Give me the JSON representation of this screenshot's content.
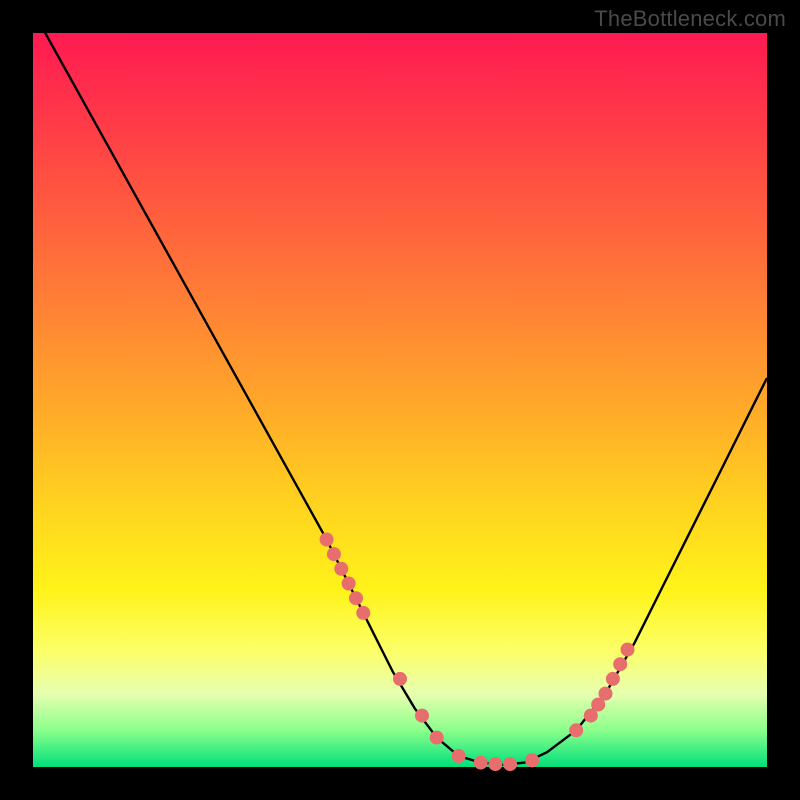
{
  "watermark": "TheBottleneck.com",
  "colors": {
    "page_bg": "#000000",
    "gradient_top": "#ff1a52",
    "gradient_bottom": "#00e07a",
    "curve_stroke": "#000000",
    "marker_fill": "#e86d6d",
    "marker_stroke": "#c94f4f"
  },
  "chart_data": {
    "type": "line",
    "title": "",
    "xlabel": "",
    "ylabel": "",
    "xlim": [
      0,
      100
    ],
    "ylim": [
      0,
      100
    ],
    "grid": false,
    "legend": false,
    "note": "Axes are unlabeled. y interpreted as 0=bottom (green, optimal) to 100=top (red, bottleneck). Values estimated from pixel positions.",
    "series": [
      {
        "name": "bottleneck-curve",
        "x": [
          0,
          5,
          10,
          15,
          20,
          25,
          30,
          35,
          40,
          43,
          46,
          49,
          52,
          55,
          58,
          61,
          64,
          67,
          70,
          74,
          78,
          82,
          86,
          90,
          94,
          98,
          100
        ],
        "y": [
          103,
          94,
          85,
          76,
          67,
          58,
          49,
          40,
          31,
          25,
          19,
          13,
          8,
          4,
          1.5,
          0.6,
          0.3,
          0.6,
          2,
          5,
          10,
          17,
          25,
          33,
          41,
          49,
          53
        ]
      }
    ],
    "markers": {
      "name": "highlighted-range-markers",
      "note": "Salmon dot markers along the curve near the trough region.",
      "x": [
        40,
        41,
        42,
        43,
        44,
        45,
        50,
        53,
        55,
        58,
        61,
        63,
        65,
        68,
        74,
        76,
        77,
        78,
        79,
        80,
        81
      ],
      "y": [
        31,
        29,
        27,
        25,
        23,
        21,
        12,
        7,
        4,
        1.5,
        0.6,
        0.4,
        0.4,
        0.9,
        5,
        7,
        8.5,
        10,
        12,
        14,
        16
      ]
    }
  }
}
